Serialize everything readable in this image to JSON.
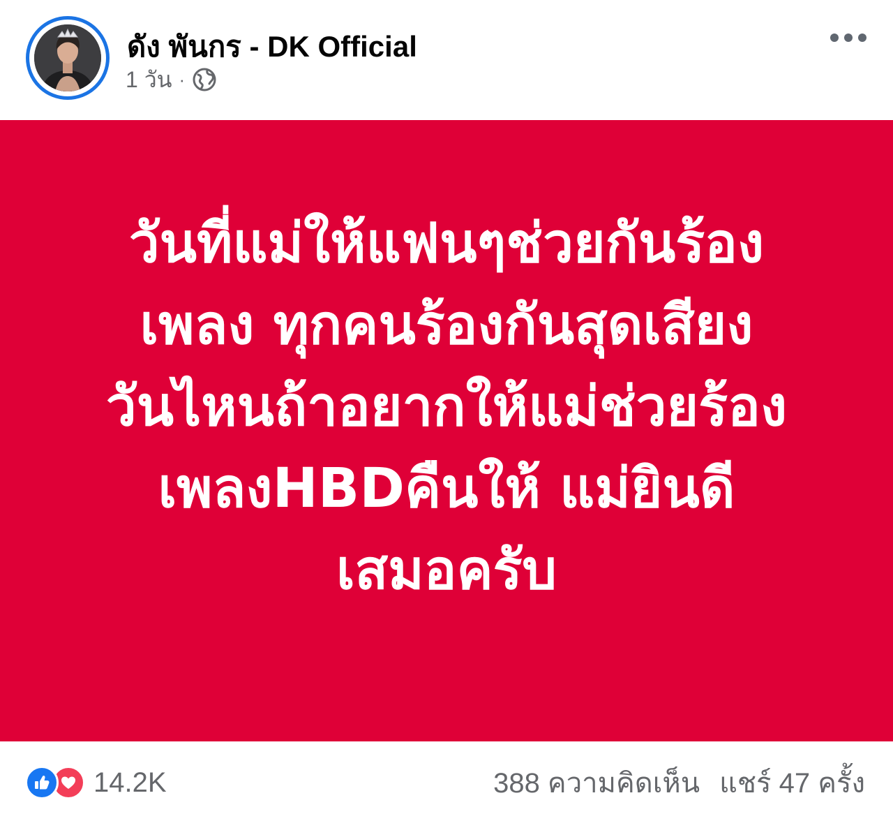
{
  "post": {
    "author": "ดัง พันกร - DK Official",
    "time": "1 วัน",
    "separator": "·",
    "privacy_icon": "globe-icon",
    "more_icon": "more-horizontal-icon"
  },
  "card": {
    "background": "#df0037",
    "text_color": "#ffffff",
    "lines": [
      "วันที่แม่ให้แฟนๆช่วยกันร้อง",
      "เพลง ทุกคนร้องกันสุดเสียง",
      "วันไหนถ้าอยากให้แม่ช่วยร้อง",
      "เพลงHBDคืนให้ แม่ยินดี",
      "เสมอครับ"
    ]
  },
  "footer": {
    "reaction_icons": [
      "like-icon",
      "love-icon"
    ],
    "reaction_count": "14.2K",
    "comments": "388 ความคิดเห็น",
    "shares": "แชร์ 47 ครั้ง"
  },
  "colors": {
    "accent": "#1b74e4",
    "like": "#1877f2",
    "love": "#f33e58",
    "muted_text": "#65676b"
  }
}
